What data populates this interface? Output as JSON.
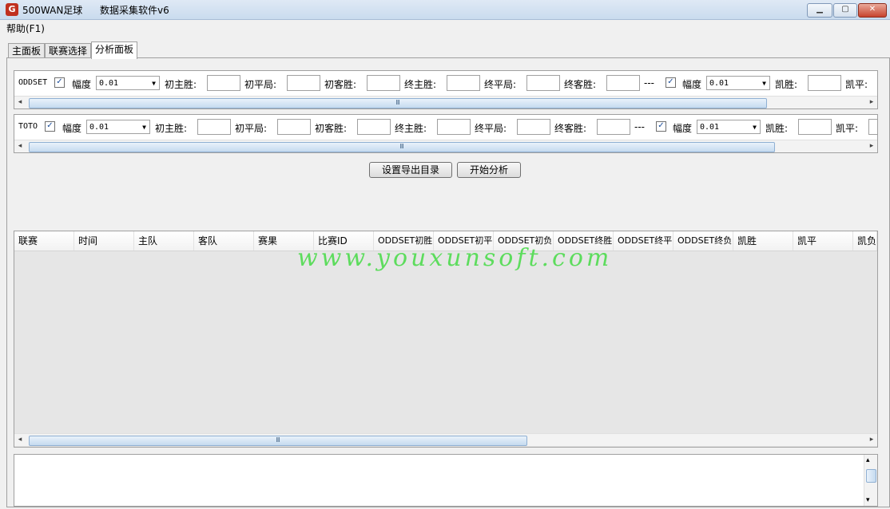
{
  "window": {
    "icon": "G",
    "title": "500WAN足球",
    "subtitle": "数据采集软件v6"
  },
  "menu": {
    "help": "帮助(F1)"
  },
  "tabs": [
    {
      "label": "主面板"
    },
    {
      "label": "联赛选择"
    },
    {
      "label": "分析面板"
    }
  ],
  "active_tab": "分析面板",
  "filters": [
    {
      "source": "ODDSET",
      "checked": true,
      "amplitude_label": "幅度",
      "amplitude_value": "0.01",
      "fields": [
        "初主胜:",
        "初平局:",
        "初客胜:",
        "终主胜:",
        "终平局:",
        "终客胜:"
      ],
      "separator": "---",
      "checked2": true,
      "amplitude_label2": "幅度",
      "amplitude_value2": "0.01",
      "fields2": [
        "凯胜:",
        "凯平:"
      ]
    },
    {
      "source": "TOTO",
      "checked": true,
      "amplitude_label": "幅度",
      "amplitude_value": "0.01",
      "fields": [
        "初主胜:",
        "初平局:",
        "初客胜:",
        "终主胜:",
        "终平局:",
        "终客胜:"
      ],
      "separator": "---",
      "checked2": true,
      "amplitude_label2": "幅度",
      "amplitude_value2": "0.01",
      "fields2": [
        "凯胜:",
        "凯平:"
      ]
    }
  ],
  "buttons": {
    "set_export_dir": "设置导出目录",
    "start_analysis": "开始分析"
  },
  "table": {
    "columns": [
      "联赛",
      "时间",
      "主队",
      "客队",
      "赛果",
      "比赛ID",
      "ODDSET初胜",
      "ODDSET初平",
      "ODDSET初负",
      "ODDSET终胜",
      "ODDSET终平",
      "ODDSET终负",
      "凯胜",
      "凯平",
      "凯负"
    ],
    "rows": []
  },
  "watermark": "www.youxunsoft.com",
  "icons": [
    "app-logo-icon",
    "minimize-icon",
    "maximize-icon",
    "close-icon",
    "checkbox-checked-icon",
    "dropdown-arrow-icon",
    "scroll-left-icon",
    "scroll-right-icon",
    "scroll-up-icon",
    "scroll-down-icon"
  ]
}
